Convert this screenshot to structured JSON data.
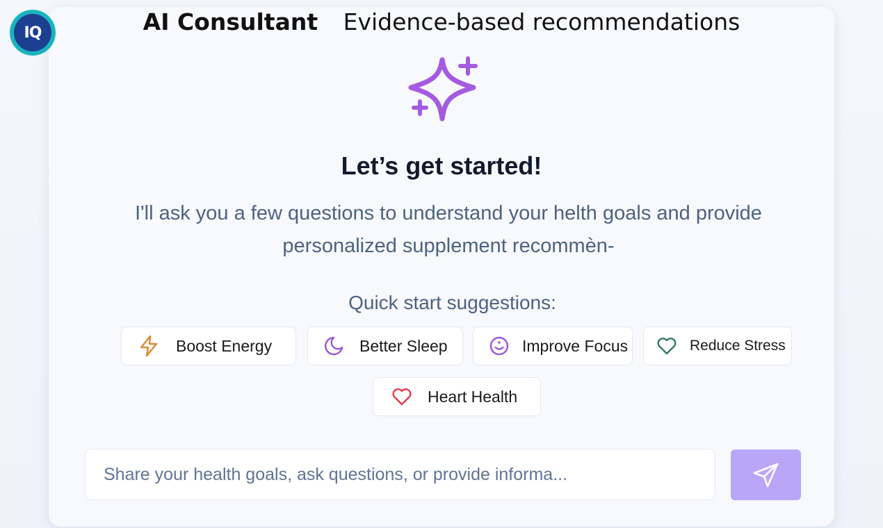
{
  "brand": {
    "logo_text": "IQ"
  },
  "header": {
    "title": "AI Consultant",
    "subtitle": "Evidence-based recommendations"
  },
  "welcome": {
    "icon": "sparkles-icon",
    "heading": "Let’s get started!",
    "intro": "I'll ask you a few questions to understand your helth goals and provide personalized supplement recommèn-"
  },
  "suggestions": {
    "label": "Quick start suggestions:",
    "items": [
      {
        "label": "Boost Energy",
        "icon": "lightning-icon",
        "color": "#d98a2b"
      },
      {
        "label": "Better Sleep",
        "icon": "moon-icon",
        "color": "#9b55d8"
      },
      {
        "label": "Improve Focus",
        "icon": "smile-icon",
        "color": "#9b55d8"
      },
      {
        "label": "Reduce Stress",
        "icon": "heart-icon",
        "color": "#2f7a5e"
      },
      {
        "label": "Heart Health",
        "icon": "heart-icon",
        "color": "#e33b4b"
      }
    ]
  },
  "composer": {
    "placeholder": "Share your health goals, ask questions, or provide informa...",
    "value": "",
    "send_icon": "send-icon",
    "send_color": "#b9a6f7"
  },
  "colors": {
    "accent": "#a45be0",
    "logo_ring": "#1bb3c0",
    "logo_fill": "#1c3f8f"
  }
}
